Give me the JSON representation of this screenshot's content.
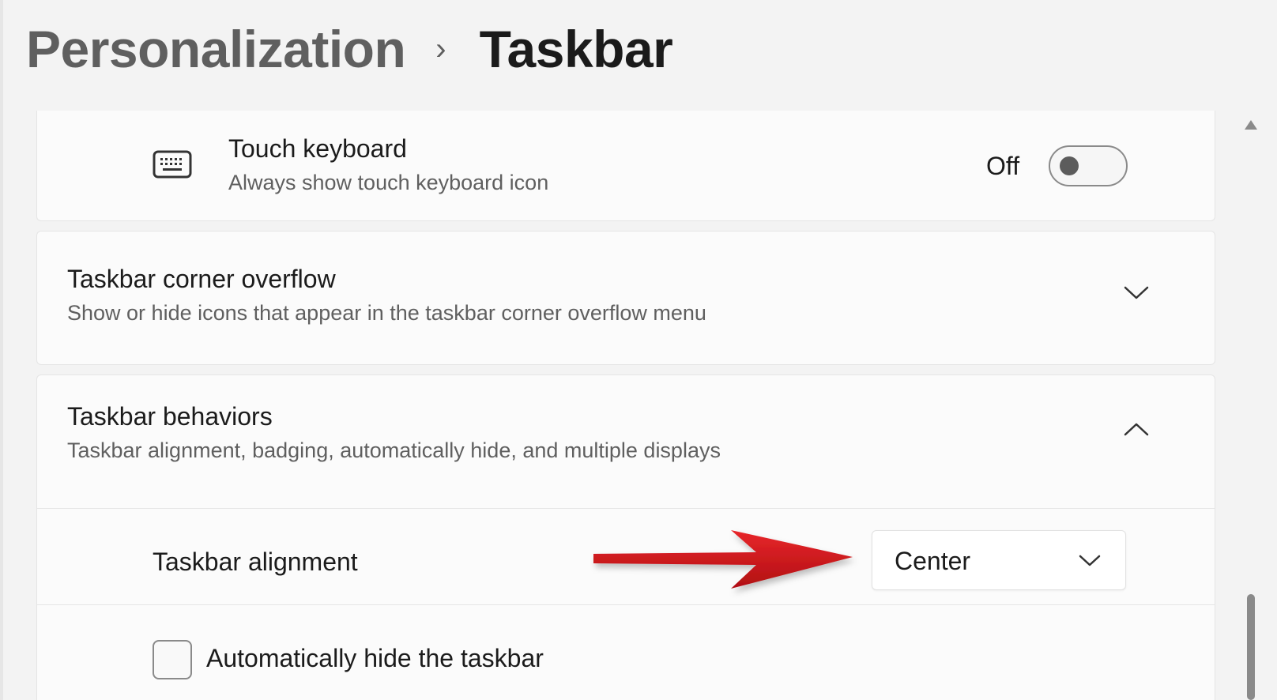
{
  "header": {
    "parent": "Personalization",
    "separator": "›",
    "current": "Taskbar"
  },
  "touch_keyboard": {
    "icon": "keyboard-icon",
    "title": "Touch keyboard",
    "subtitle": "Always show touch keyboard icon",
    "toggle_state_label": "Off",
    "toggle_on": false
  },
  "corner_overflow": {
    "title": "Taskbar corner overflow",
    "subtitle": "Show or hide icons that appear in the taskbar corner overflow menu",
    "expanded": false
  },
  "behaviors": {
    "title": "Taskbar behaviors",
    "subtitle": "Taskbar alignment, badging, automatically hide, and multiple displays",
    "expanded": true,
    "alignment": {
      "label": "Taskbar alignment",
      "selected": "Center"
    },
    "auto_hide": {
      "label": "Automatically hide the taskbar",
      "checked": false
    }
  },
  "annotation": {
    "arrow_color": "#d01418"
  }
}
